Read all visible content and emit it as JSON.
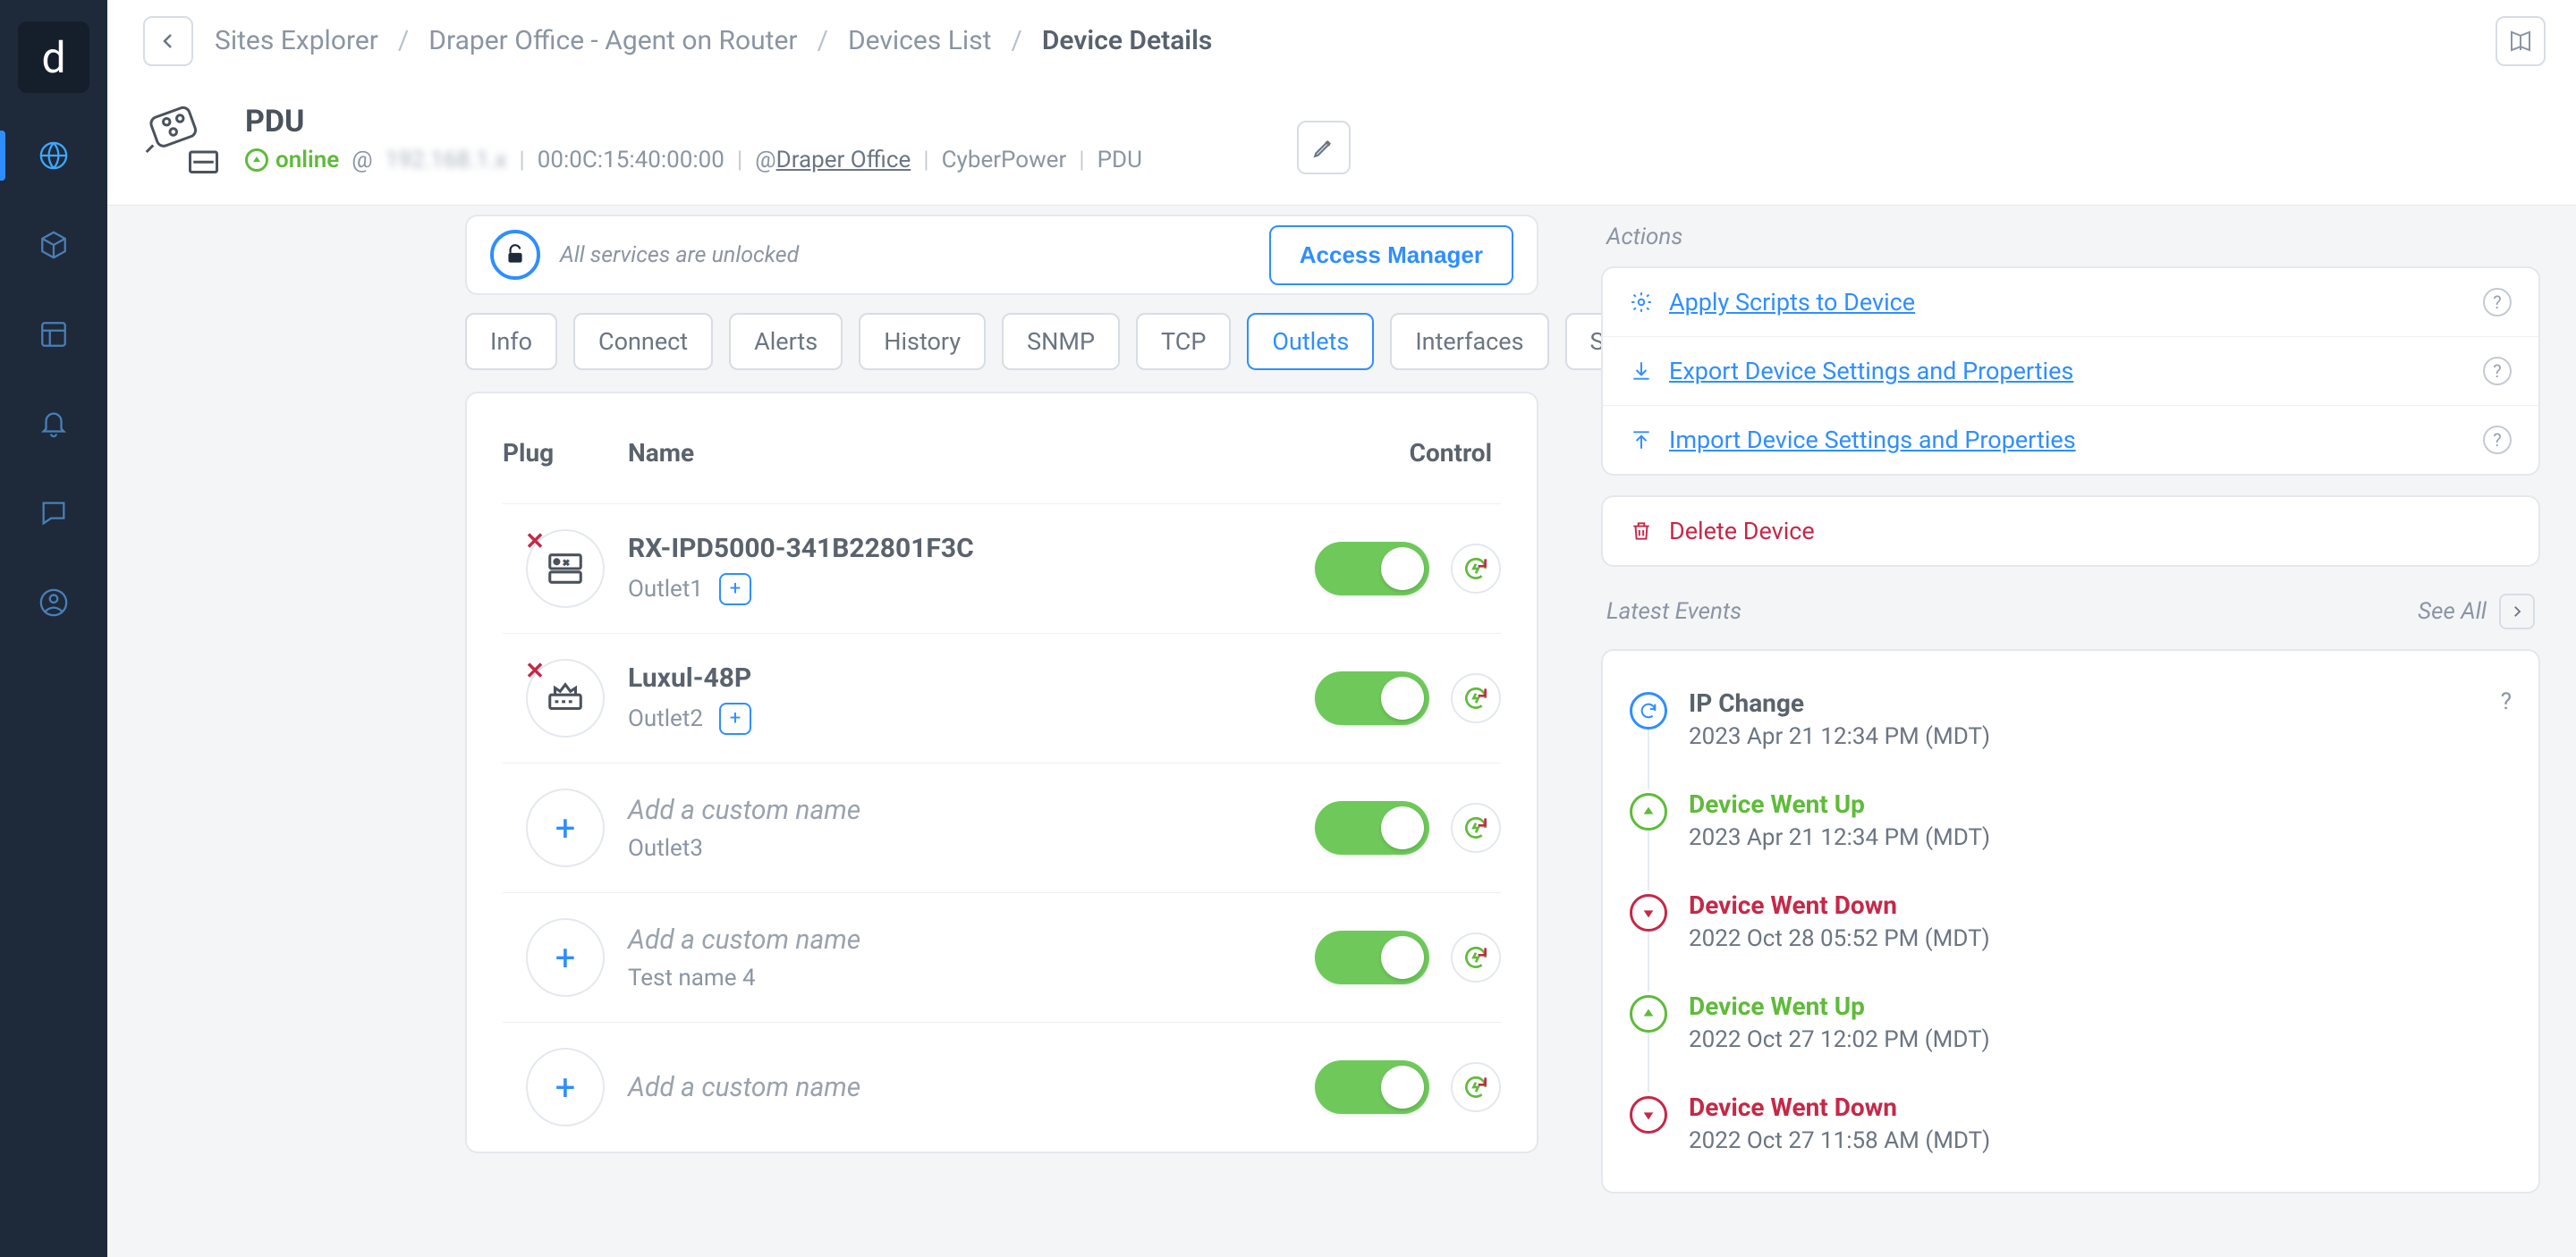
{
  "breadcrumbs": {
    "items": [
      "Sites Explorer",
      "Draper Office - Agent on Router",
      "Devices List",
      "Device Details"
    ],
    "sep": "/"
  },
  "device": {
    "title": "PDU",
    "status": "online",
    "at": "@",
    "ip_blur": "192.168.1.x",
    "mac": "00:0C:15:40:00:00",
    "site_prefix": "@",
    "site": "Draper Office",
    "vendor": "CyberPower",
    "type": "PDU"
  },
  "services": {
    "message": "All services are unlocked",
    "button": "Access Manager"
  },
  "tabs": [
    "Info",
    "Connect",
    "Alerts",
    "History",
    "SNMP",
    "TCP",
    "Outlets",
    "Interfaces",
    "Sensor"
  ],
  "active_tab": "Outlets",
  "outlet_table": {
    "col_plug": "Plug",
    "col_name": "Name",
    "col_control": "Control",
    "placeholder": "Add a custom name",
    "rows": [
      {
        "name": "RX-IPD5000-341B22801F3C",
        "sub": "Outlet1",
        "has_plug": true
      },
      {
        "name": "Luxul-48P",
        "sub": "Outlet2",
        "has_plug": true
      },
      {
        "name": "",
        "sub": "Outlet3",
        "has_plug": false
      },
      {
        "name": "",
        "sub": "Test name 4",
        "has_plug": false
      },
      {
        "name": "",
        "sub": "",
        "has_plug": false
      }
    ]
  },
  "actions": {
    "title": "Actions",
    "apply": "Apply Scripts to Device",
    "export": "Export Device Settings and Properties",
    "import": "Import Device Settings and Properties",
    "delete": "Delete Device"
  },
  "events": {
    "title": "Latest Events",
    "see_all": "See All",
    "items": [
      {
        "title": "IP Change",
        "time": "2023 Apr 21 12:34 PM (MDT)",
        "kind": "sync",
        "help": true
      },
      {
        "title": "Device Went Up",
        "time": "2023 Apr 21 12:34 PM (MDT)",
        "kind": "up"
      },
      {
        "title": "Device Went Down",
        "time": "2022 Oct 28 05:52 PM (MDT)",
        "kind": "down"
      },
      {
        "title": "Device Went Up",
        "time": "2022 Oct 27 12:02 PM (MDT)",
        "kind": "up"
      },
      {
        "title": "Device Went Down",
        "time": "2022 Oct 27 11:58 AM (MDT)",
        "kind": "down"
      }
    ]
  }
}
